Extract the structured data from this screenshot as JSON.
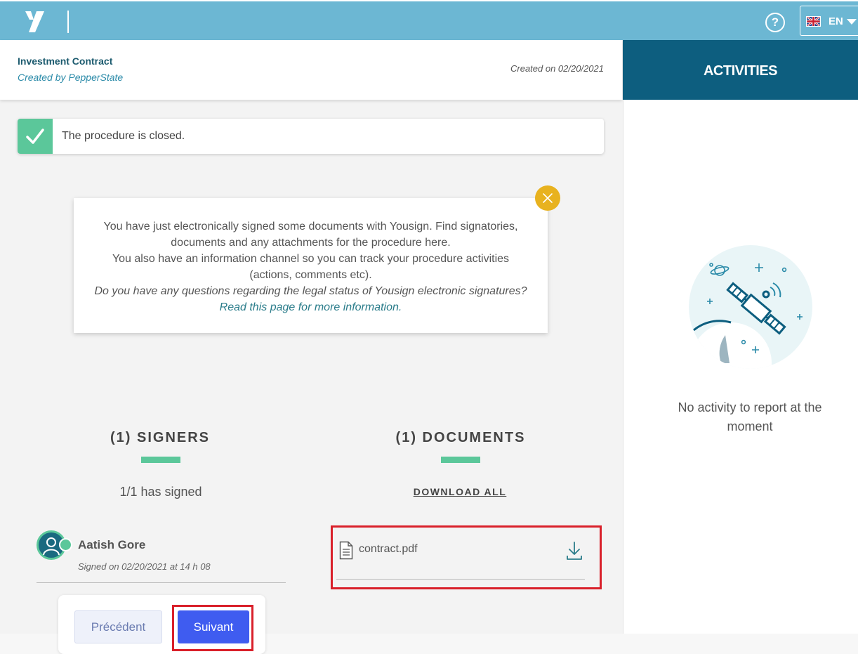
{
  "header": {
    "lang_label": "EN",
    "help_symbol": "?"
  },
  "document": {
    "title": "Investment Contract",
    "created_by": "Created by PepperState",
    "created_on": "Created on 02/20/2021"
  },
  "activities": {
    "title": "ACTIVITIES",
    "empty_text": "No activity to report at the moment"
  },
  "status": {
    "text": "The procedure is closed."
  },
  "info": {
    "line1": "You have just electronically signed some documents with Yousign. Find signatories, documents and any attachments for the procedure here.",
    "line2": "You also have an information channel so you can track your procedure activities (actions, comments etc).",
    "question": "Do you have any questions regarding the legal status of Yousign electronic signatures?",
    "link": "Read this page for more information."
  },
  "signers": {
    "title": "(1) SIGNERS",
    "count_text": "1/1 has signed",
    "items": [
      {
        "name": "Aatish Gore",
        "signed_on": "Signed on 02/20/2021 at 14 h 08"
      }
    ]
  },
  "documents": {
    "title": "(1) DOCUMENTS",
    "download_all": "DOWNLOAD ALL",
    "items": [
      {
        "name": "contract.pdf"
      }
    ]
  },
  "navigation": {
    "prev_label": "Précédent",
    "next_label": "Suivant"
  },
  "colors": {
    "topbar": "#6cb7d3",
    "activities_header": "#0d5e7f",
    "success": "#5bc79a",
    "accent_yellow": "#e8b21f",
    "primary_button": "#3f5cf0",
    "highlight_red": "#d9202a"
  },
  "icons": {
    "logo": "yousign-logo-icon",
    "help": "help-icon",
    "flag": "uk-flag-icon",
    "caret": "caret-down-icon",
    "check": "check-icon",
    "close": "close-icon",
    "satellite": "satellite-illustration",
    "user": "user-icon",
    "file": "file-icon",
    "download": "download-icon"
  }
}
